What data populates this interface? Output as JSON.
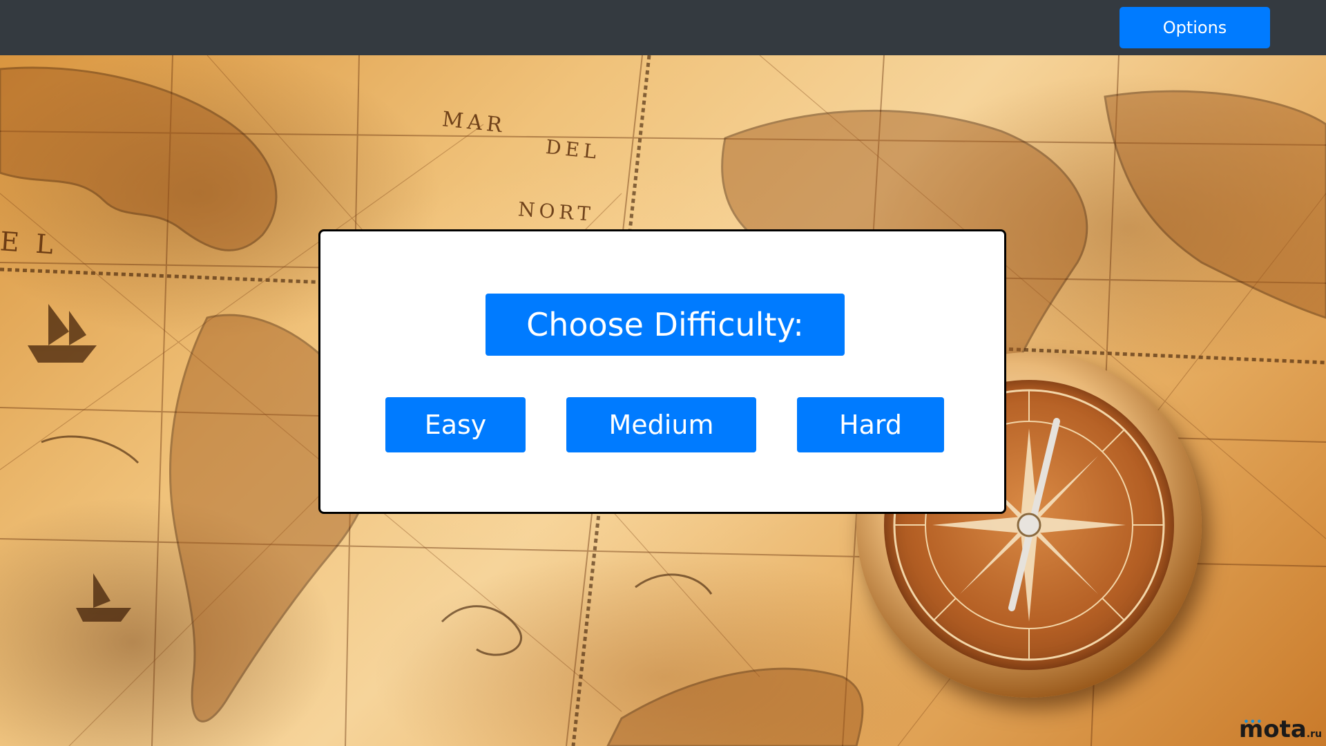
{
  "navbar": {
    "options_label": "Options"
  },
  "modal": {
    "title": "Choose Difficulty:",
    "buttons": [
      {
        "label": "Easy"
      },
      {
        "label": "Medium"
      },
      {
        "label": "Hard"
      }
    ]
  },
  "map": {
    "labels": [
      "MAR",
      "DEL",
      "NORT",
      "E L"
    ]
  },
  "watermark": {
    "text": "mota",
    "suffix": ".ru"
  },
  "colors": {
    "navbar_bg": "#343a40",
    "button_blue": "#007bff",
    "modal_bg": "#ffffff",
    "modal_border": "#000000"
  },
  "icons": {
    "compass": "compass-icon"
  }
}
